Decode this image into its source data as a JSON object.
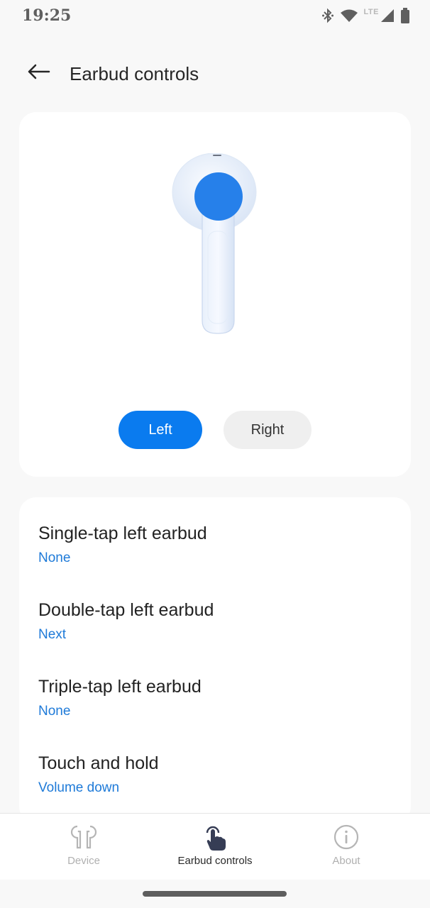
{
  "status_bar": {
    "time": "19:25",
    "network_label": "LTE",
    "icons": [
      "bluetooth-icon",
      "wifi-icon",
      "cell-signal-icon",
      "battery-icon"
    ]
  },
  "app_bar": {
    "title": "Earbud controls",
    "back_icon": "arrow-left-icon"
  },
  "earbud_selector": {
    "options": [
      {
        "label": "Left",
        "selected": true
      },
      {
        "label": "Right",
        "selected": false
      }
    ],
    "accent_color": "#0a7bef"
  },
  "settings": [
    {
      "title": "Single-tap left earbud",
      "value": "None"
    },
    {
      "title": "Double-tap left earbud",
      "value": "Next"
    },
    {
      "title": "Triple-tap left earbud",
      "value": "None"
    },
    {
      "title": "Touch and hold",
      "value": "Volume down"
    }
  ],
  "bottom_nav": {
    "items": [
      {
        "label": "Device",
        "icon": "earbuds-icon",
        "active": false
      },
      {
        "label": "Earbud controls",
        "icon": "touch-hand-icon",
        "active": true
      },
      {
        "label": "About",
        "icon": "info-icon",
        "active": false
      }
    ]
  },
  "colors": {
    "accent": "#0a7bef",
    "value_text": "#1e7ad8",
    "background": "#f8f8f8"
  }
}
